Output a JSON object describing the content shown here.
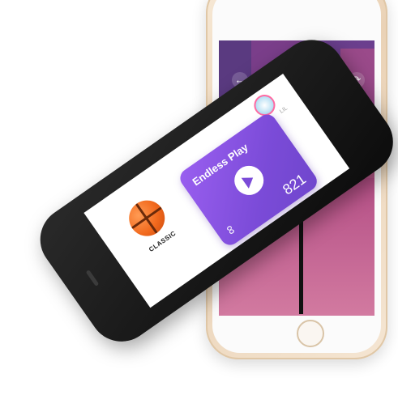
{
  "game_screen": {
    "back_icon": "arrow-left-icon",
    "reload_icon": "reload-icon"
  },
  "menu_screen": {
    "ball_name": "CLASSIC",
    "mode_title": "Endless Play",
    "score": "821",
    "side_tag": "LIL",
    "play_icon": "play-triangle-icon",
    "link_icon": "link-icon"
  },
  "colors": {
    "accent_purple": "#7b4bd8",
    "accent_blue": "#4ab8ef",
    "rim_orange": "#ff6a3c"
  }
}
